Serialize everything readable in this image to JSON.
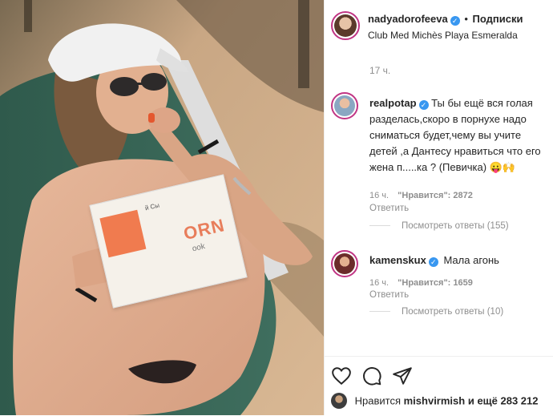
{
  "post": {
    "author": "nadyadorofeeva",
    "dot": "•",
    "follow_label": "Подписки",
    "location": "Club Med Michès Playa Esmeralda",
    "time_ago": "17 ч."
  },
  "book_cover": {
    "line1": "й Cы",
    "line2": "ORN",
    "line3": "ook"
  },
  "comments": [
    {
      "username": "realpotap",
      "text": "Ты бы ещё вся голая разделась,скоро в порнухе надо сниматься будет,чему вы учите детей ,а Дантесу нравиться что его жена п.....ка ? (Певичка) 😛🙌",
      "time": "16 ч.",
      "likes": "\"Нравится\": 2872",
      "reply": "Ответить",
      "view_replies": "Посмотреть ответы (155)"
    },
    {
      "username": "kamenskux",
      "text": "Мала агонь",
      "time": "16 ч.",
      "likes": "\"Нравится\": 1659",
      "reply": "Ответить",
      "view_replies": "Посмотреть ответы (10)"
    }
  ],
  "likes_bar": {
    "prefix": "Нравится",
    "user": "mishvirmish",
    "suffix": "и ещё 283 212"
  },
  "icons": {
    "verified": "verified-badge-icon",
    "like": "heart-icon",
    "comment": "comment-icon",
    "share": "paper-plane-icon"
  },
  "colors": {
    "verified_blue": "#3897f0",
    "link_blue": "#00376b",
    "muted": "#8e8e8e"
  }
}
